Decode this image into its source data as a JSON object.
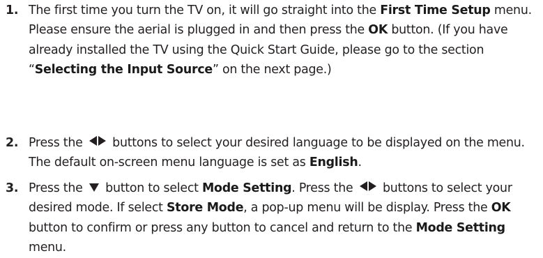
{
  "steps": [
    {
      "number": "1.",
      "segments": [
        "The first time you turn the TV on, it will go straight into the ",
        "First Time Setup",
        " menu. Please ensure the aerial is plugged in and then press the ",
        "OK",
        " button. (If you have already installed the TV using the Quick Start Guide, please go to the section “",
        "Selecting the Input Source",
        "” on the next page.)"
      ]
    },
    {
      "number": "2.",
      "segments": [
        "Press the ",
        " buttons to select your desired language to be displayed on the menu.  The default on-screen menu language is set as ",
        "English",
        "."
      ],
      "icons": [
        "left-arrow-icon",
        "right-arrow-icon"
      ]
    },
    {
      "number": "3.",
      "segments": [
        "Press the ",
        " button to select ",
        "Mode Setting",
        ". Press the ",
        " buttons to select your desired mode. If select ",
        "Store Mode",
        ", a pop-up menu will be display. Press the ",
        "OK",
        " button to confirm or press any button to cancel and return to the ",
        "Mode Setting",
        " menu."
      ],
      "icons": [
        "down-arrow-icon",
        "left-arrow-icon",
        "right-arrow-icon"
      ]
    }
  ]
}
